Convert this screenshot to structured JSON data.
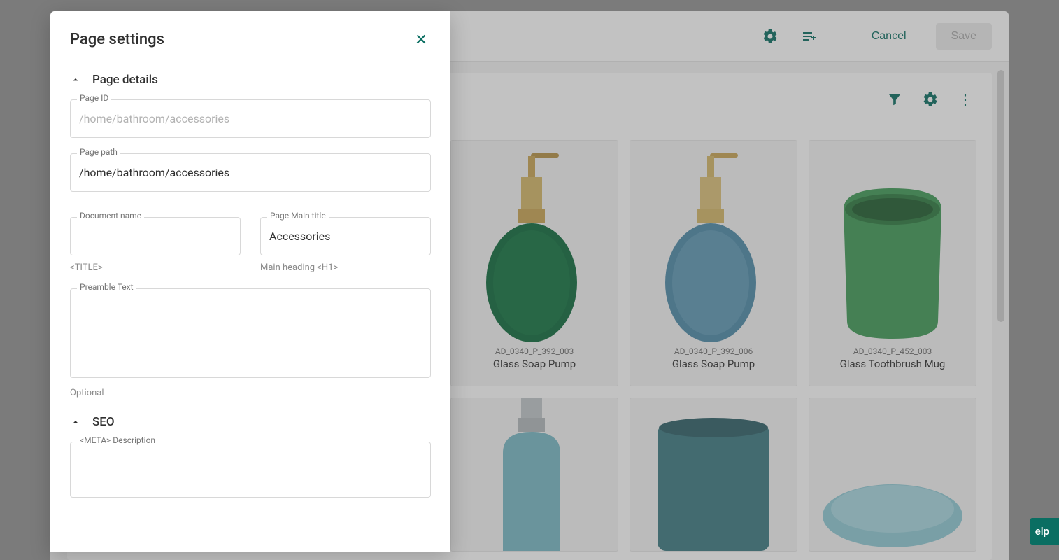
{
  "toolbar": {
    "cancel_label": "Cancel",
    "save_label": "Save"
  },
  "modal": {
    "title": "Page settings",
    "sections": {
      "page_details": {
        "title": "Page details",
        "page_id_label": "Page ID",
        "page_id_value": "/home/bathroom/accessories",
        "page_path_label": "Page path",
        "page_path_value": "/home/bathroom/accessories",
        "document_name_label": "Document name",
        "document_name_value": "",
        "document_name_helper": "<TITLE>",
        "main_title_label": "Page Main title",
        "main_title_value": "Accessories",
        "main_title_helper": "Main heading <H1>",
        "preamble_label": "Preamble Text",
        "preamble_value": "",
        "preamble_helper": "Optional"
      },
      "seo": {
        "title": "SEO",
        "meta_desc_label": "<META> Description",
        "meta_desc_value": ""
      }
    }
  },
  "products": [
    {
      "sku": "AD_0340_P_392_003",
      "name": "Glass Soap Pump"
    },
    {
      "sku": "AD_0340_P_392_006",
      "name": "Glass Soap Pump"
    },
    {
      "sku": "AD_0340_P_452_003",
      "name": "Glass Toothbrush Mug"
    }
  ],
  "help_label": "elp"
}
